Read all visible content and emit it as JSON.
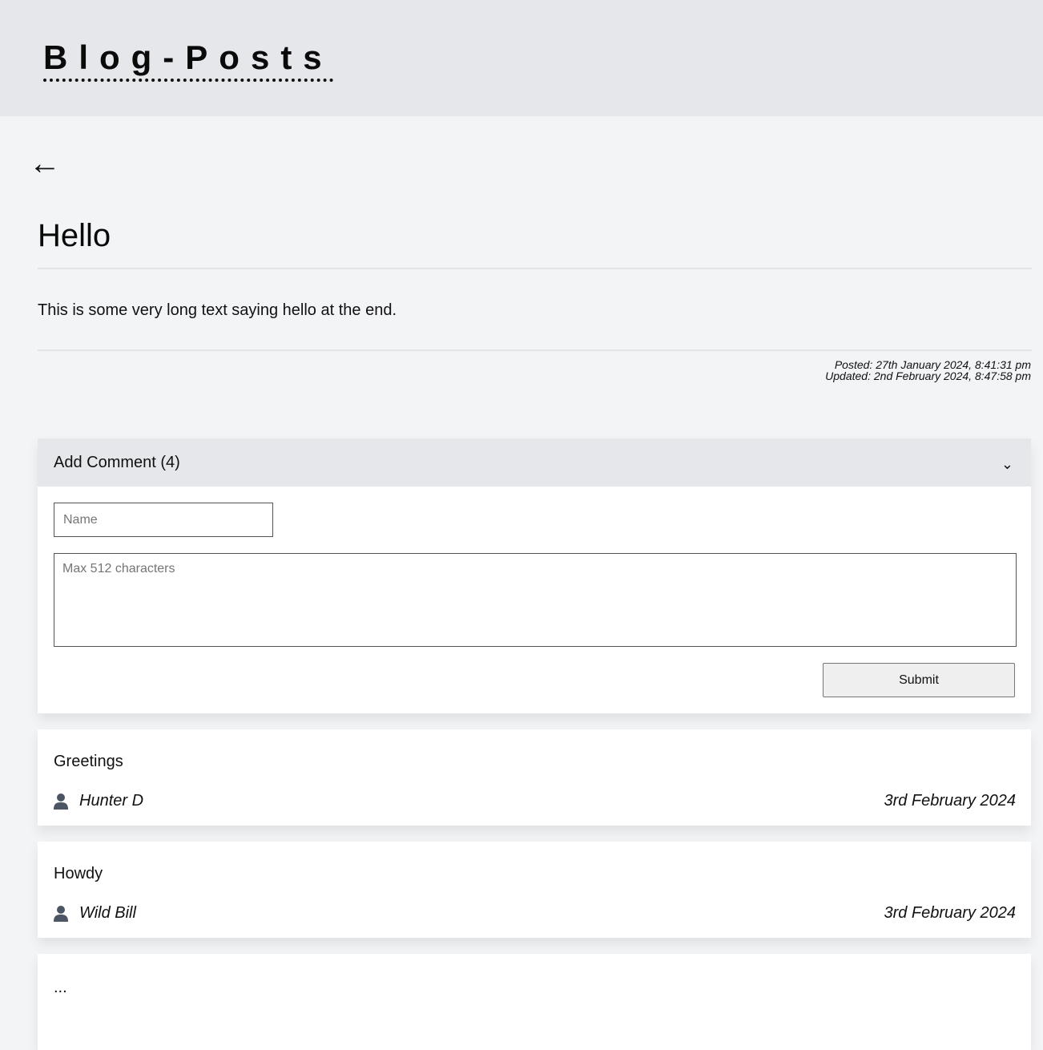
{
  "header": {
    "site_title": "Blog-Posts"
  },
  "nav": {
    "back_arrow": "←"
  },
  "post": {
    "title": "Hello",
    "body": "This is some very long text saying hello at the end.",
    "posted": "Posted: 27th January 2024, 8:41:31 pm",
    "updated": "Updated: 2nd February 2024, 8:47:58 pm"
  },
  "comment_form": {
    "header_label": "Add Comment (4)",
    "chevron": "⌄",
    "name_placeholder": "Name",
    "name_value": "",
    "comment_placeholder": "Max 512 characters",
    "comment_value": "",
    "submit_label": "Submit"
  },
  "comments": [
    {
      "text": "Greetings",
      "author": "Hunter D",
      "date": "3rd February 2024",
      "icon": "user-icon"
    },
    {
      "text": "Howdy",
      "author": "Wild Bill",
      "date": "3rd February 2024",
      "icon": "user-icon"
    },
    {
      "text": "...",
      "author": "",
      "date": "",
      "icon": "user-icon"
    }
  ],
  "colors": {
    "page_bg": "#f3f4f6",
    "header_bg": "#e5e7eb",
    "card_bg": "#ffffff",
    "icon": "#4b5563"
  }
}
